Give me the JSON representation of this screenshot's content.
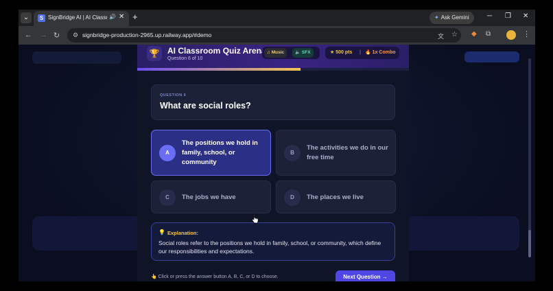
{
  "browser": {
    "tab_title": "SignBridge AI | AI Classroo",
    "tab_favicon": "S",
    "new_tab": "+",
    "gemini_label": "Ask Gemini",
    "url": "signbridge-production-2965.up.railway.app/#demo"
  },
  "quiz": {
    "title": "AI Classroom Quiz Arena",
    "progress_text": "Question 6 of 10",
    "progress_fraction": 0.6,
    "music_label": "Music",
    "sfx_label": "SFX",
    "points": "500 pts",
    "combo": "1x Combo"
  },
  "question": {
    "label": "QUESTION 6",
    "text": "What are social roles?"
  },
  "answers": [
    {
      "letter": "A",
      "text": "The positions we hold in family, school, or community",
      "selected": true
    },
    {
      "letter": "B",
      "text": "The activities we do in our free time",
      "selected": false
    },
    {
      "letter": "C",
      "text": "The jobs we have",
      "selected": false
    },
    {
      "letter": "D",
      "text": "The places we live",
      "selected": false
    }
  ],
  "explanation": {
    "title": "Explanation:",
    "text": "Social roles refer to the positions we hold in family, school, or community, which define our responsibilities and expectations."
  },
  "footer": {
    "hint": "Click or press the answer button A, B, C, or D to choose.",
    "next_label": "Next Question"
  },
  "colors": {
    "accent": "#4f46e5",
    "selected_border": "#6a6ef5",
    "gold": "#f5c451"
  }
}
